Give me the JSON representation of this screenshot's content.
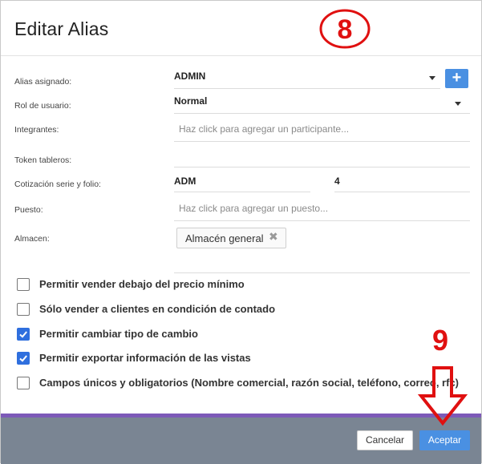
{
  "dialog": {
    "title": "Editar Alias"
  },
  "fields": {
    "alias": {
      "label": "Alias asignado:",
      "value": "ADMIN"
    },
    "rol": {
      "label": "Rol de usuario:",
      "value": "Normal"
    },
    "integrantes": {
      "label": "Integrantes:",
      "placeholder": "Haz click para agregar un participante..."
    },
    "token": {
      "label": "Token tableros:",
      "value": ""
    },
    "cotizacion": {
      "label": "Cotización serie y folio:",
      "serie": "ADM",
      "folio": "4"
    },
    "puesto": {
      "label": "Puesto:",
      "placeholder": "Haz click para agregar un puesto..."
    },
    "almacen": {
      "label": "Almacen:",
      "chip": "Almacén general"
    }
  },
  "add_button_label": "+",
  "checkboxes": [
    {
      "label": "Permitir vender debajo del precio mínimo",
      "checked": false
    },
    {
      "label": "Sólo vender a clientes en condición de contado",
      "checked": false
    },
    {
      "label": "Permitir cambiar tipo de cambio",
      "checked": true
    },
    {
      "label": "Permitir exportar información de las vistas",
      "checked": true
    },
    {
      "label": "Campos únicos y obligatorios (Nombre comercial, razón social, teléfono, correo, rfc)",
      "checked": false
    }
  ],
  "footer": {
    "cancel_label": "Cancelar",
    "ok_label": "Aceptar"
  },
  "annotations": {
    "step_a": "8",
    "step_b": "9"
  },
  "colors": {
    "accent": "#4a90e2",
    "checkbox": "#2f6fde",
    "footer_bar": "#7a8593",
    "purple_strip": "#7d5ab8",
    "annotation_red": "#e01010"
  }
}
